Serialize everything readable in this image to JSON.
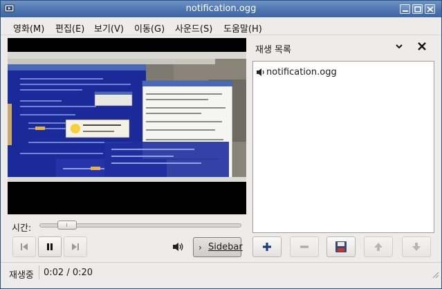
{
  "window": {
    "title": "notification.ogg"
  },
  "menu": [
    "영화(M)",
    "편집(E)",
    "보기(V)",
    "이동(G)",
    "사운드(S)",
    "도움말(H)"
  ],
  "seek": {
    "label": "시간:",
    "position_fraction": 0.1
  },
  "sidebar": {
    "title": "재생 목록",
    "toggle_label": "Sidebar",
    "toggle_arrow": "›",
    "playlist": [
      {
        "label": "notification.ogg",
        "icon": "speaker-icon"
      }
    ]
  },
  "controls": {
    "previous": {
      "icon": "skip-previous-icon",
      "enabled": false
    },
    "pause": {
      "icon": "pause-icon",
      "enabled": true
    },
    "next": {
      "icon": "skip-next-icon",
      "enabled": false
    },
    "volume": {
      "icon": "volume-icon"
    }
  },
  "playlist_buttons": [
    {
      "icon": "add-icon",
      "enabled": true
    },
    {
      "icon": "remove-icon",
      "enabled": false
    },
    {
      "icon": "save-icon",
      "enabled": true
    },
    {
      "icon": "move-up-icon",
      "enabled": false
    },
    {
      "icon": "move-down-icon",
      "enabled": false
    }
  ],
  "status": {
    "state": "재생중",
    "time": "0:02 / 0:20"
  },
  "colors": {
    "titlebar": "#4d75b0",
    "video_background": "#000000",
    "video_desktop_blue": "#1a2f9e"
  }
}
